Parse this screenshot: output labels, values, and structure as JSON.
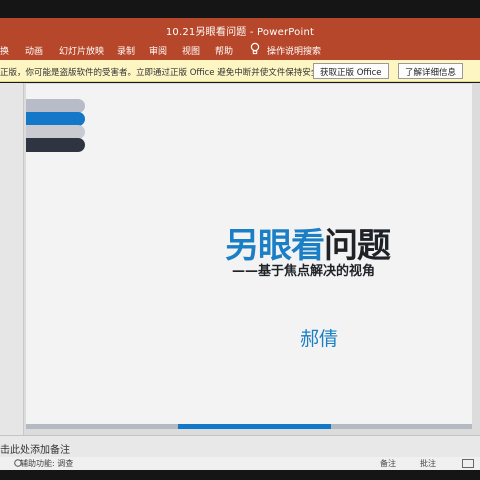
{
  "window": {
    "title": "10.21另眼看问题  -  PowerPoint"
  },
  "menu": {
    "items": [
      "换",
      "动画",
      "幻灯片放映",
      "录制",
      "审阅",
      "视图",
      "帮助"
    ],
    "tell_me": "操作说明搜索"
  },
  "notice": {
    "message": "正版，你可能是盗版软件的受害者。立即通过正版 Office 避免中断并使文件保持安全。",
    "get_genuine": "获取正版 Office",
    "learn_more": "了解详细信息"
  },
  "slide": {
    "title_blue": "另眼看",
    "title_dark": "问题",
    "subtitle": "——基于焦点解决的视角",
    "author": "郝倩",
    "progress": 0.34
  },
  "notes": {
    "placeholder": "击此处添加备注"
  },
  "statusbar": {
    "accessibility": "辅助功能: 调查",
    "notes_label": "备注",
    "comments_label": "批注"
  },
  "colors": {
    "ribbon": "#b7472a",
    "accent_blue": "#1b7fc6",
    "notice_bg": "#fdf6c3"
  }
}
